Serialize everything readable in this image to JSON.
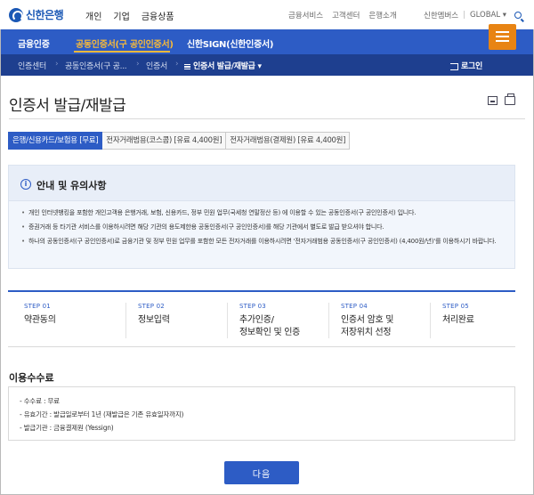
{
  "brand": {
    "logo_text": "신한은행"
  },
  "top_nav": [
    "개인",
    "기업",
    "금융상품"
  ],
  "util_nav": [
    "금융서비스",
    "고객센터",
    "은행소개"
  ],
  "right_nav": {
    "members": "신한멤버스",
    "global": "GLOBAL ▾"
  },
  "blue_nav": [
    "금융인증",
    "공동인증서(구 공인인증서)",
    "신한SIGN(신한인증서)"
  ],
  "breadcrumb": [
    "인증센터",
    "공동인증서(구 공...",
    "인증서",
    "인증서 발급/재발급"
  ],
  "login_label": "로그인",
  "page_title": "인증서 발급/재발급",
  "tabs": [
    "은행/신용카드/보험용 [무료]",
    "전자거래범용(코스콤) [유료 4,400원]",
    "전자거래범용(결제원) [유료 4,400원]"
  ],
  "notice": {
    "title": "안내 및 유의사항",
    "items": [
      "개인 인터넷뱅킹을 포함한 개인고객용 은행거래, 보험, 신용카드, 정부 민원 업무(국세청 연말정산 등) 에 이용할 수 있는 공동인증서(구 공인인증서) 입니다.",
      "증권거래 등 타기관 서비스를 이용하시려면 해당 기관의 용도제한용 공동인증서(구 공인인증서)를 해당 기관에서 별도로 발급 받으셔야 합니다.",
      "하나의 공동인증서(구 공인인증서)로 금융기관 및 정부 민원 업무를 포함한 모든 전자거래를 이용하시려면 '전자거래범용 공동인증서(구 공인인증서) (4,400원/년)'를 이용하시기 바랍니다."
    ]
  },
  "steps": [
    {
      "num": "STEP 01",
      "label": "약관동의"
    },
    {
      "num": "STEP 02",
      "label": "정보입력"
    },
    {
      "num": "STEP 03",
      "label": "추가인증/",
      "label2": "정보확인 및 인증"
    },
    {
      "num": "STEP 04",
      "label": "인증서 암호 및",
      "label2": "저장위치 선정"
    },
    {
      "num": "STEP 05",
      "label": "처리완료"
    }
  ],
  "fee": {
    "title": "이용수수료",
    "items": [
      "- 수수료 : 무료",
      "- 유효기간 : 발급일로부터 1년 (재발급은 기존 유효일자까지)",
      "- 발급기관 : 금융결제원 (Yessign)"
    ]
  },
  "next_button": "다음",
  "colors": {
    "primary": "#2d5cc5",
    "dark_nav": "#1e3f8f",
    "accent": "#f6b93b",
    "menu": "#e88413"
  }
}
